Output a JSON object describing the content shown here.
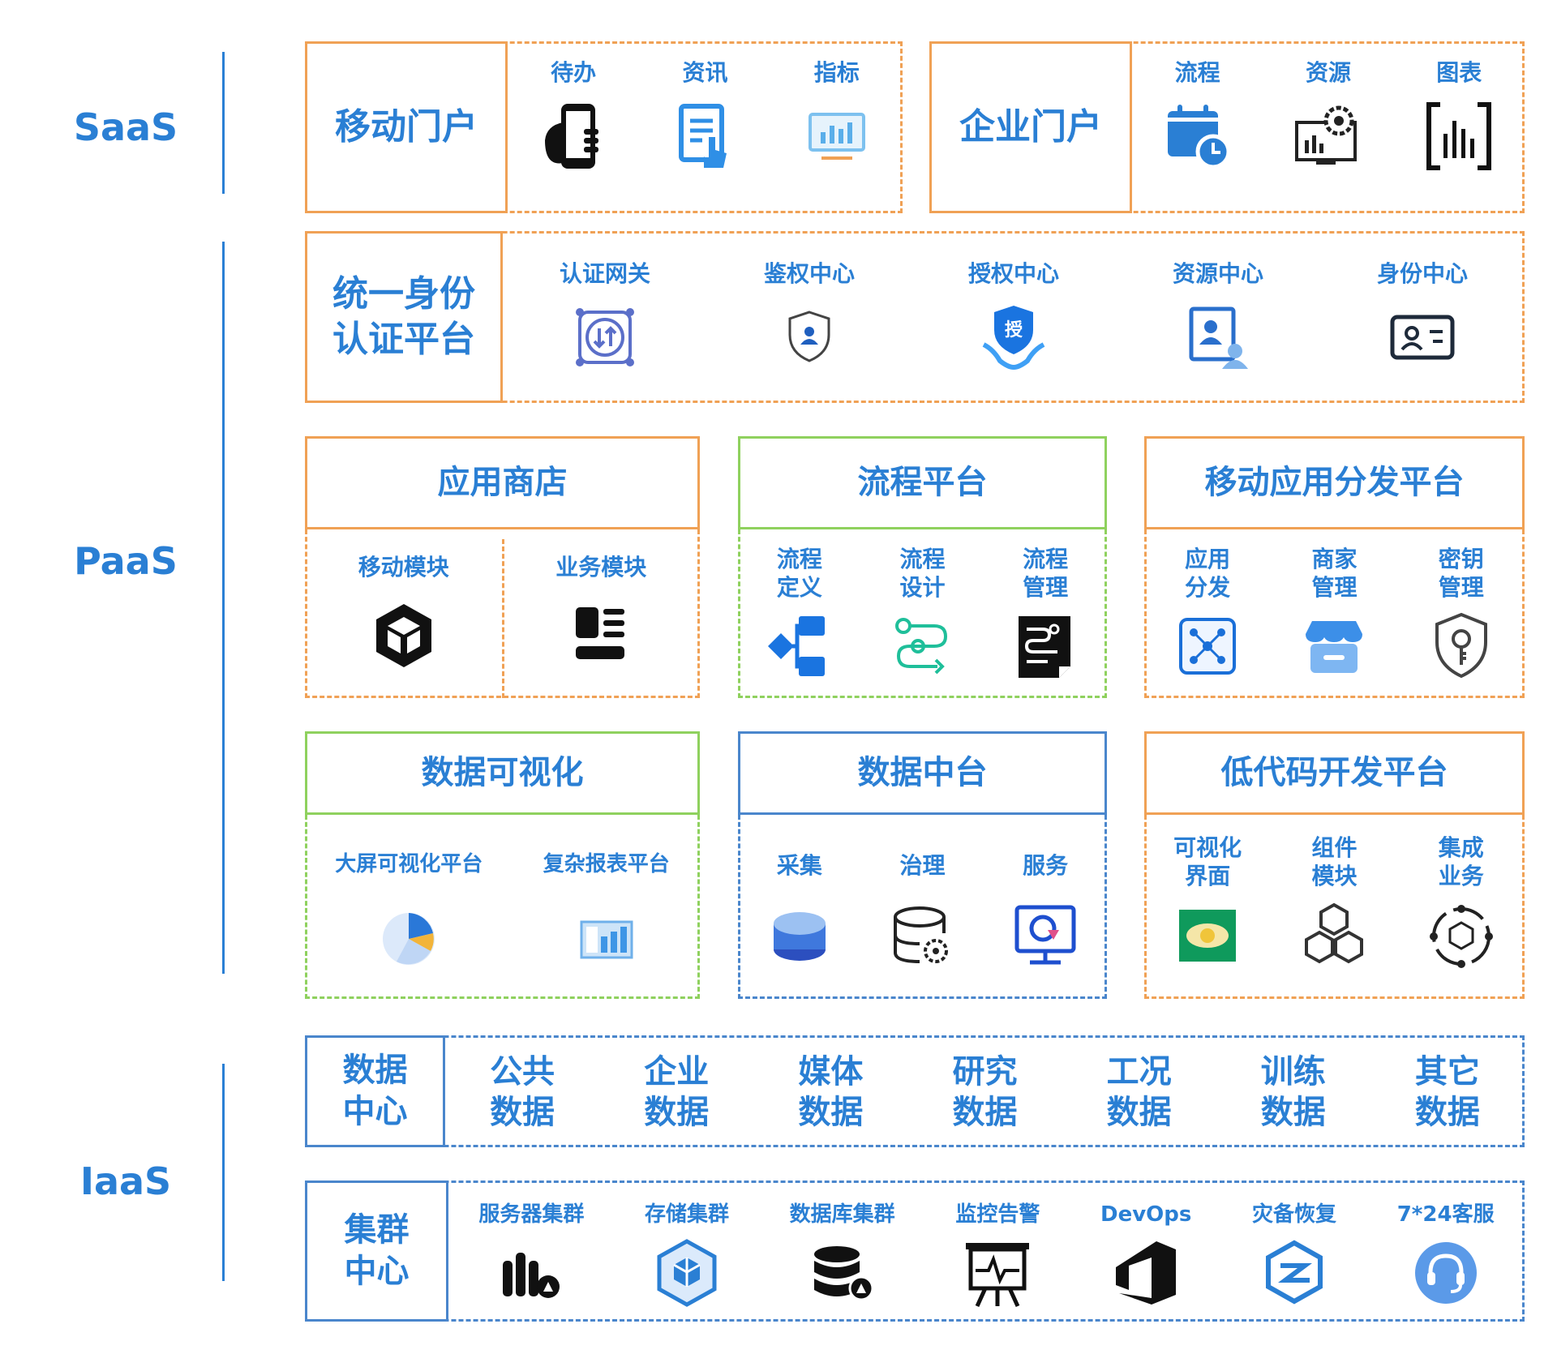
{
  "layers": {
    "saas": "SaaS",
    "paas": "PaaS",
    "iaas": "IaaS"
  },
  "saas": {
    "mobile_portal": {
      "title": "移动门户",
      "items": [
        {
          "label": "待办",
          "icon": "phone-hand-icon"
        },
        {
          "label": "资讯",
          "icon": "doc-touch-icon"
        },
        {
          "label": "指标",
          "icon": "monitor-chart-icon"
        }
      ]
    },
    "enterprise_portal": {
      "title": "企业门户",
      "items": [
        {
          "label": "流程",
          "icon": "calendar-clock-icon"
        },
        {
          "label": "资源",
          "icon": "gear-screen-icon"
        },
        {
          "label": "图表",
          "icon": "bar-bracket-icon"
        }
      ]
    }
  },
  "identity": {
    "title_line1": "统一身份",
    "title_line2": "认证平台",
    "items": [
      {
        "label": "认证网关",
        "icon": "gateway-icon"
      },
      {
        "label": "鉴权中心",
        "icon": "shield-user-icon"
      },
      {
        "label": "授权中心",
        "icon": "shield-hand-icon",
        "glyph": "授"
      },
      {
        "label": "资源中心",
        "icon": "user-card-icon"
      },
      {
        "label": "身份中心",
        "icon": "id-card-icon"
      }
    ]
  },
  "app_store": {
    "title": "应用商店",
    "items": [
      {
        "label": "移动模块",
        "icon": "cube-icon"
      },
      {
        "label": "业务模块",
        "icon": "module-list-icon"
      }
    ]
  },
  "process_platform": {
    "title": "流程平台",
    "items": [
      {
        "label": "流程\n定义",
        "icon": "flow-tree-icon"
      },
      {
        "label": "流程\n设计",
        "icon": "flow-path-icon"
      },
      {
        "label": "流程\n管理",
        "icon": "flow-doc-icon"
      }
    ]
  },
  "mobile_distribution": {
    "title": "移动应用分发平台",
    "items": [
      {
        "label": "应用\n分发",
        "icon": "network-icon"
      },
      {
        "label": "商家\n管理",
        "icon": "store-icon"
      },
      {
        "label": "密钥\n管理",
        "icon": "key-shield-icon"
      }
    ]
  },
  "data_visual": {
    "title": "数据可视化",
    "items": [
      {
        "label": "大屏可视化平台",
        "icon": "pie-chart-icon"
      },
      {
        "label": "复杂报表平台",
        "icon": "report-icon"
      }
    ]
  },
  "data_middle": {
    "title": "数据中台",
    "items": [
      {
        "label": "采集",
        "icon": "database-icon"
      },
      {
        "label": "治理",
        "icon": "db-gear-icon"
      },
      {
        "label": "服务",
        "icon": "monitor-service-icon"
      }
    ]
  },
  "lowcode": {
    "title": "低代码开发平台",
    "items": [
      {
        "label": "可视化\n界面",
        "icon": "eye-screen-icon"
      },
      {
        "label": "组件\n模块",
        "icon": "cubes-icon"
      },
      {
        "label": "集成\n业务",
        "icon": "cycle-cube-icon"
      }
    ]
  },
  "data_center": {
    "title_line1": "数据",
    "title_line2": "中心",
    "items": [
      {
        "line1": "公共",
        "line2": "数据"
      },
      {
        "line1": "企业",
        "line2": "数据"
      },
      {
        "line1": "媒体",
        "line2": "数据"
      },
      {
        "line1": "研究",
        "line2": "数据"
      },
      {
        "line1": "工况",
        "line2": "数据"
      },
      {
        "line1": "训练",
        "line2": "数据"
      },
      {
        "line1": "其它",
        "line2": "数据"
      }
    ]
  },
  "cluster_center": {
    "title_line1": "集群",
    "title_line2": "中心",
    "items": [
      {
        "label": "服务器集群",
        "icon": "server-icon"
      },
      {
        "label": "存储集群",
        "icon": "storage-icon"
      },
      {
        "label": "数据库集群",
        "icon": "db-cluster-icon"
      },
      {
        "label": "监控告警",
        "icon": "monitor-board-icon"
      },
      {
        "label": "DevOps",
        "icon": "devops-icon"
      },
      {
        "label": "灾备恢复",
        "icon": "recovery-icon"
      },
      {
        "label": "7*24客服",
        "icon": "headset-icon"
      }
    ]
  },
  "colors": {
    "blue": "#2a7fd4",
    "orange": "#f0a155",
    "green": "#8fd15e",
    "frame_blue": "#4a86cc"
  }
}
